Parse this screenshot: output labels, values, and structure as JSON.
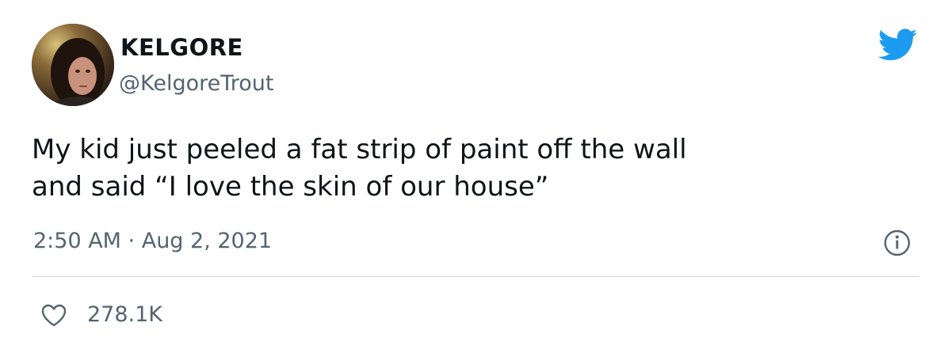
{
  "tweet": {
    "display_name": "KELGORE",
    "handle": "@KelgoreTrout",
    "text": "My kid just peeled a fat strip of paint off the wall\nand said “I love the skin of our house”",
    "timestamp": "2:50 AM · Aug 2, 2021",
    "like_count": "278.1K"
  },
  "icons": {
    "brand": "twitter-bird-icon",
    "info": "info-icon",
    "like": "heart-icon"
  },
  "colors": {
    "text_primary": "#0f1419",
    "text_secondary": "#536471",
    "twitter_blue": "#1d9bf0",
    "divider": "#cfd9de"
  }
}
